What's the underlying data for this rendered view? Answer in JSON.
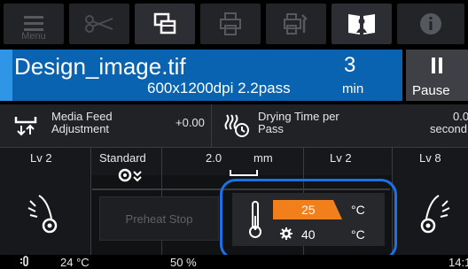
{
  "toolbar": {
    "menu_label": "Menu",
    "buttons": [
      "menu-icon",
      "cut-icon",
      "copy-layers-icon",
      "printer-icon",
      "printer-settings-icon",
      "manual-icon",
      "info-icon"
    ]
  },
  "job": {
    "filename": "Design_image.tif",
    "resolution": "600x1200dpi 2.2pass",
    "remaining_value": "3",
    "remaining_unit": "min"
  },
  "pause": {
    "label": "Pause"
  },
  "info_row": {
    "media_feed_label_1": "Media Feed",
    "media_feed_label_2": "Adjustment",
    "media_feed_value": "+0.00",
    "drying_label_1": "Drying Time per",
    "drying_label_2": "Pass",
    "drying_value": "0.0",
    "drying_unit": "second"
  },
  "levels": {
    "left_level": "Lv 2",
    "mode": "Standard",
    "gap_value": "2.0",
    "gap_unit": "mm",
    "mid_level": "Lv 2",
    "right_level": "Lv 8"
  },
  "heater": {
    "preheat_label": "Preheat Stop",
    "current_temp": "25",
    "current_unit": "°C",
    "set_temp": "40",
    "set_unit": "°C"
  },
  "status": {
    "ambient_temp": "24 °C",
    "humidity": "50 %",
    "time": "14:1"
  },
  "colors": {
    "accent_blue": "#0a63b0",
    "focus_blue": "#1a72e6",
    "temp_orange": "#f07f1c"
  }
}
